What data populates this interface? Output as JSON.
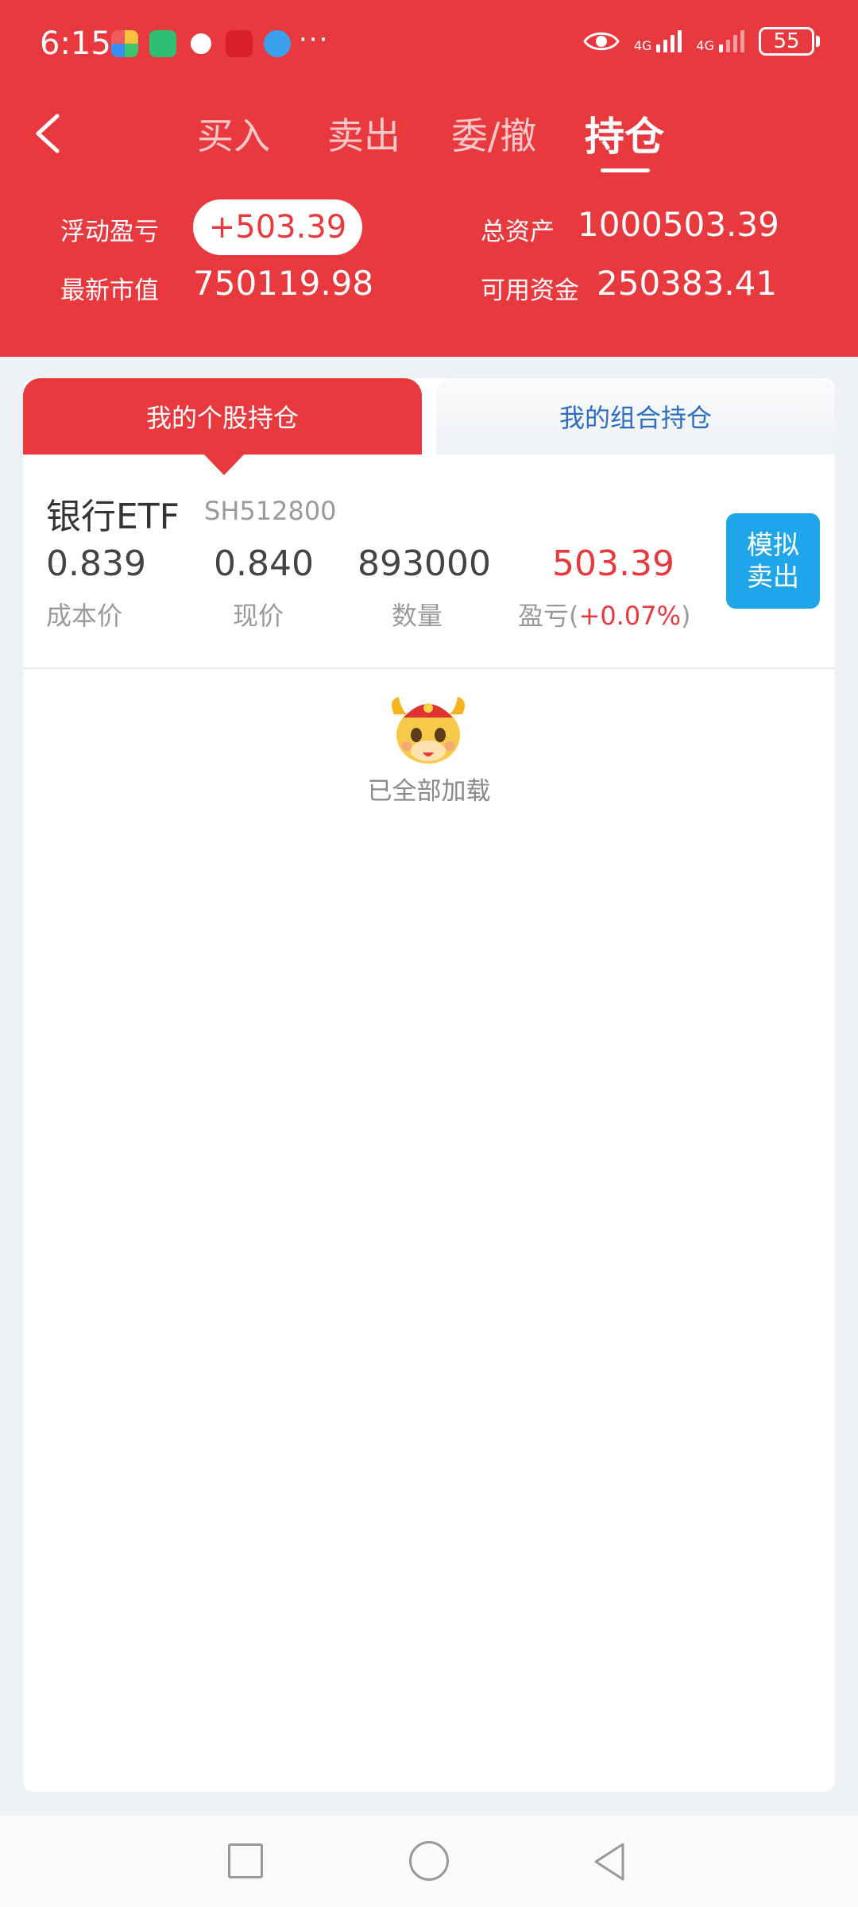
{
  "status_bar": {
    "time": "6:15",
    "battery": "55",
    "net1": "4G",
    "net2": "4G",
    "overflow": "···"
  },
  "nav": {
    "tabs": [
      "买入",
      "卖出",
      "委/撤",
      "持仓"
    ],
    "active_tab": "持仓"
  },
  "summary": {
    "floating_pl_label": "浮动盈亏",
    "floating_pl_value": "+503.39",
    "market_value_label": "最新市值",
    "market_value": "750119.98",
    "total_assets_label": "总资产",
    "total_assets": "1000503.39",
    "available_funds_label": "可用资金",
    "available_funds": "250383.41"
  },
  "holdings_tabs": {
    "stock": "我的个股持仓",
    "portfolio": "我的组合持仓"
  },
  "holding": {
    "name": "银行ETF",
    "code": "SH512800",
    "cost_price": "0.839",
    "cost_label": "成本价",
    "current_price": "0.840",
    "current_label": "现价",
    "quantity": "893000",
    "quantity_label": "数量",
    "pl": "503.39",
    "pl_label_prefix": "盈亏(",
    "pl_percent": "+0.07%",
    "pl_label_suffix": ")",
    "sell_line1": "模拟",
    "sell_line2": "卖出"
  },
  "loaded_text": "已全部加载",
  "colors": {
    "brand_red": "#e8393f",
    "sell_blue": "#1fa5ea",
    "link_blue": "#2d6fc2"
  }
}
